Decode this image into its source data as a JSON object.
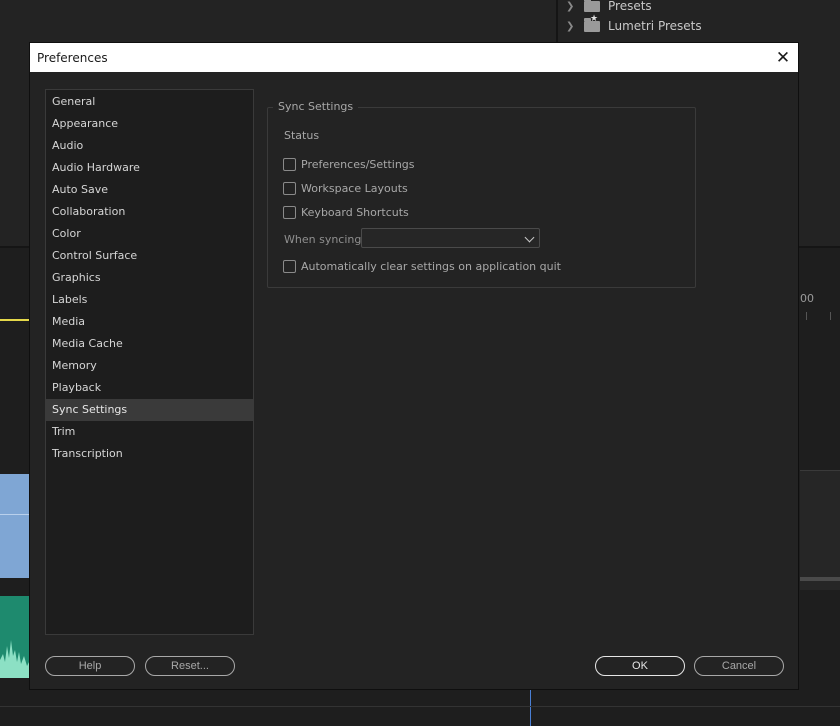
{
  "background": {
    "project_tree": [
      "Presets",
      "Lumetri Presets"
    ],
    "ruler_label": "00"
  },
  "dialog": {
    "title": "Preferences",
    "close_glyph": "✕",
    "nav": [
      {
        "label": "General"
      },
      {
        "label": "Appearance"
      },
      {
        "label": "Audio"
      },
      {
        "label": "Audio Hardware"
      },
      {
        "label": "Auto Save"
      },
      {
        "label": "Collaboration"
      },
      {
        "label": "Color"
      },
      {
        "label": "Control Surface"
      },
      {
        "label": "Graphics"
      },
      {
        "label": "Labels"
      },
      {
        "label": "Media"
      },
      {
        "label": "Media Cache"
      },
      {
        "label": "Memory"
      },
      {
        "label": "Playback"
      },
      {
        "label": "Sync Settings",
        "selected": true
      },
      {
        "label": "Trim"
      },
      {
        "label": "Transcription"
      }
    ],
    "sync": {
      "group_title": "Sync Settings",
      "status_label": "Status",
      "checkboxes": [
        {
          "label": "Preferences/Settings",
          "checked": false
        },
        {
          "label": "Workspace Layouts",
          "checked": false
        },
        {
          "label": "Keyboard Shortcuts",
          "checked": false
        }
      ],
      "when_syncing_label": "When syncing:",
      "when_syncing_value": "",
      "auto_clear_label": "Automatically clear settings on application quit",
      "auto_clear_checked": false
    },
    "buttons": {
      "help": "Help",
      "reset": "Reset...",
      "ok": "OK",
      "cancel": "Cancel"
    }
  }
}
